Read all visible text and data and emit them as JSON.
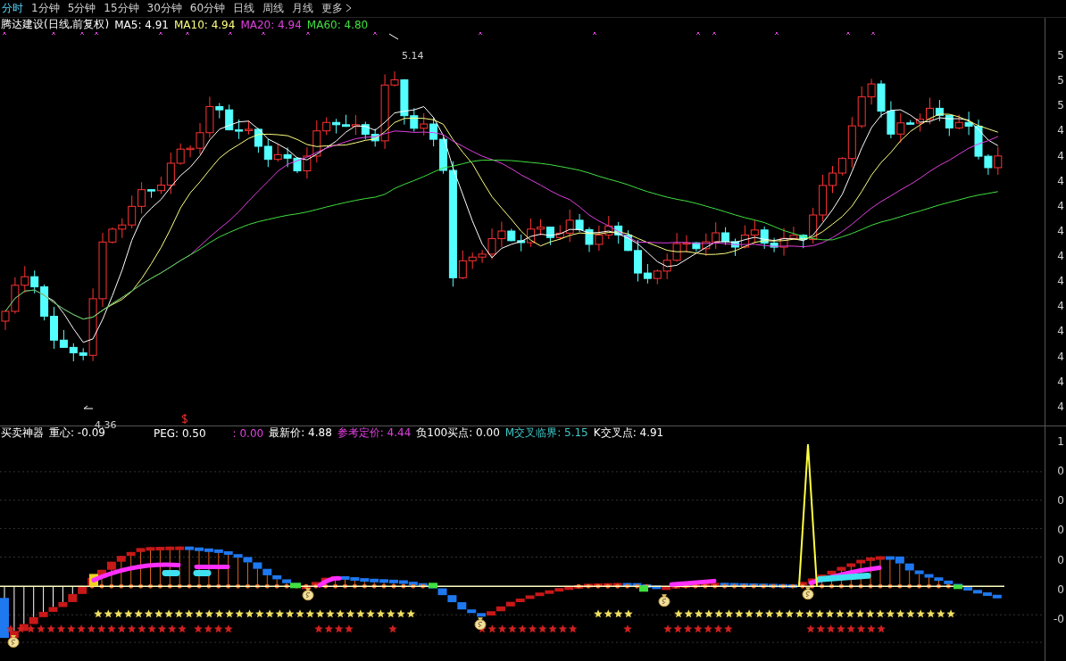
{
  "tabs": [
    {
      "label": "分时",
      "selected": true,
      "kind": "period"
    },
    {
      "label": "1分钟",
      "selected": false,
      "kind": "period"
    },
    {
      "label": "5分钟",
      "selected": false,
      "kind": "period"
    },
    {
      "label": "15分钟",
      "selected": false,
      "kind": "period"
    },
    {
      "label": "30分钟",
      "selected": false,
      "kind": "period"
    },
    {
      "label": "60分钟",
      "selected": false,
      "kind": "period"
    },
    {
      "label": "日线",
      "selected": false,
      "kind": "period"
    },
    {
      "label": "周线",
      "selected": false,
      "kind": "period"
    },
    {
      "label": "月线",
      "selected": false,
      "kind": "period"
    },
    {
      "label": "更多",
      "selected": false,
      "kind": "menu"
    }
  ],
  "price_pane": {
    "title": "腾达建设(日线,前复权)",
    "indicators": [
      {
        "label": "MA5: 4.91",
        "color": "#ffffff"
      },
      {
        "label": "MA10: 4.94",
        "color": "#ffff80"
      },
      {
        "label": "MA20: 4.94",
        "color": "#e040e0"
      },
      {
        "label": "MA60: 4.80",
        "color": "#40e040"
      }
    ],
    "high_label": "5.14",
    "low_label": "4.36",
    "axis_labels": [
      "5",
      "5",
      "5",
      "4",
      "4",
      "4",
      "4",
      "4",
      "4",
      "4",
      "4",
      "4",
      "4",
      "4",
      "4"
    ]
  },
  "indicator_pane": {
    "name": "买卖神器",
    "fields": [
      {
        "label": "重心: -0.09",
        "color": "#ffffff"
      },
      {
        "label": "PEG: 0.50",
        "color": "#ffffff"
      },
      {
        "label": ": 0.00",
        "color": "#e040e0"
      },
      {
        "label": "最新价: 4.88",
        "color": "#ffffff"
      },
      {
        "label": "参考定价: 4.44",
        "color": "#e040e0"
      },
      {
        "label": "负100买点: 0.00",
        "color": "#ffffff"
      },
      {
        "label": "M交叉临界: 5.15",
        "color": "#40c8c8"
      },
      {
        "label": "K交叉点: 4.91",
        "color": "#ffffff"
      }
    ],
    "axis_labels": [
      "1",
      "0",
      "0",
      "0",
      "0",
      "0",
      "-0"
    ]
  }
}
